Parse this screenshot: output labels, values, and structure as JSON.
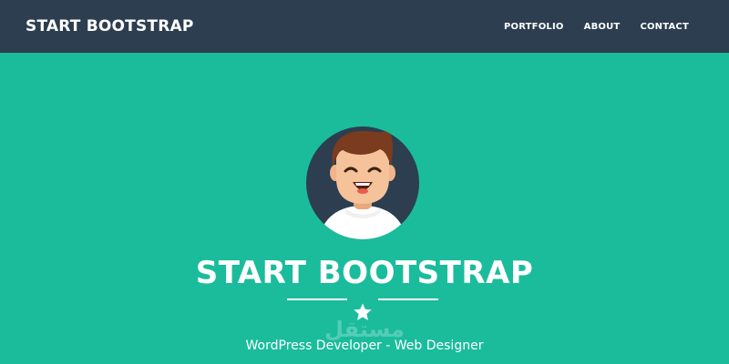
{
  "navbar": {
    "brand": "START BOOTSTRAP",
    "links": [
      {
        "label": "PORTFOLIO"
      },
      {
        "label": "ABOUT"
      },
      {
        "label": "CONTACT"
      }
    ]
  },
  "masthead": {
    "avatar_icon": "avatar-icon",
    "title": "START BOOTSTRAP",
    "divider_icon": "star-icon",
    "subtitle": "WordPress Developer - Web Designer",
    "watermark": "مستقل"
  },
  "colors": {
    "navbar_bg": "#2c3e50",
    "masthead_bg": "#1abc9c",
    "text": "#ffffff",
    "avatar_bg": "#2c3e50"
  }
}
